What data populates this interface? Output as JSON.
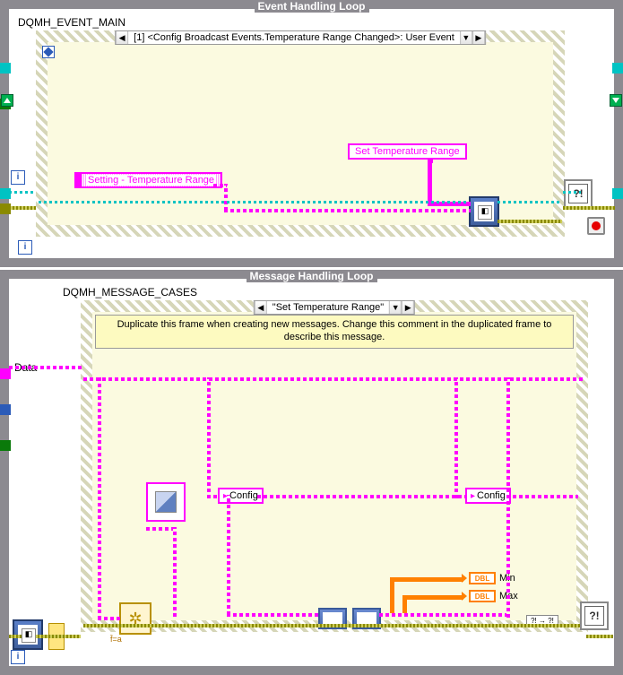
{
  "event_loop": {
    "title": "Event Handling Loop",
    "structure_label": "DQMH_EVENT_MAIN",
    "case_index": "[1]",
    "case_name": "<Config Broadcast Events.Temperature Range Changed>: User Event",
    "setting_label": "Setting - Temperature Range",
    "enqueue_label": "Set Temperature Range"
  },
  "message_loop": {
    "title": "Message Handling Loop",
    "structure_label": "DQMH_MESSAGE_CASES",
    "case_name": "\"Set Temperature Range\"",
    "comment": "Duplicate this frame when creating new messages.  Change this comment in the duplicated frame to describe this message.",
    "data_label": "Data",
    "config_label_left": "Config",
    "config_label_right": "Config",
    "min_label": "Min",
    "max_label": "Max",
    "dbl_type": "DBL",
    "coerce_label": "?! → ?!"
  },
  "chart_data": {
    "type": "diagram",
    "note": "LabVIEW block diagram; no numeric chart data present."
  }
}
